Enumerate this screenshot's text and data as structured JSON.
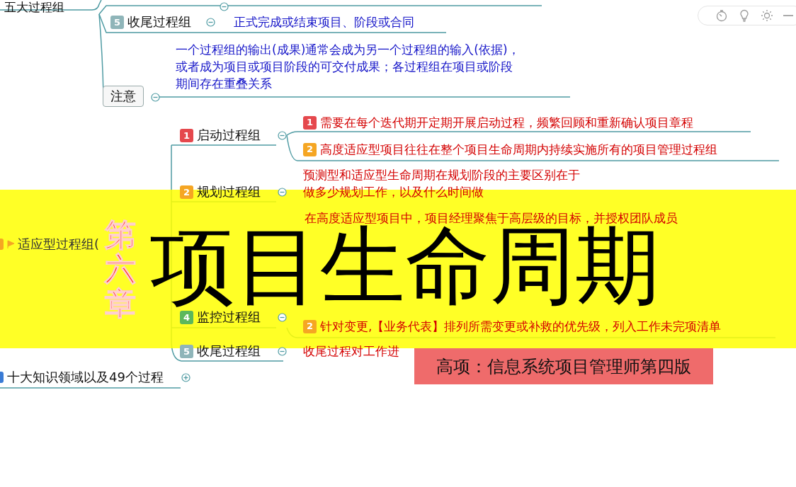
{
  "toolbar": {
    "tools": [
      {
        "kind": "timer"
      },
      {
        "kind": "bulb"
      },
      {
        "kind": "sun"
      }
    ]
  },
  "root_branch": {
    "label": "五大过程组",
    "expanded": true
  },
  "closing_node": {
    "badge": "5",
    "color": "#8fb5b9",
    "label": "收尾过程组",
    "expanded": true,
    "note": "正式完成或结束项目、阶段或合同"
  },
  "note_node": {
    "label": "注意",
    "expanded": true,
    "lines": [
      "一个过程组的输出(成果)通常会成为另一个过程组的输入(依据)，",
      "或者成为项目或项目阶段的可交付成果；各过程组在项目或阶段",
      "期间存在重叠关系"
    ]
  },
  "adaptive_node": {
    "label": "适应型过程组("
  },
  "groups": [
    {
      "badge": "1",
      "color": "#e5484d",
      "label": "启动过程组",
      "expanded": true,
      "notes": [
        {
          "badge": "1",
          "color": "#e5484d",
          "text": "需要在每个迭代期开定期开展启动过程，频繁回顾和重新确认项目章程"
        },
        {
          "badge": "2",
          "color": "#f5a623",
          "text": "高度适应型项目往往在整个项目生命周期内持续实施所有的项目管理过程组"
        }
      ]
    },
    {
      "badge": "2",
      "color": "#f5a623",
      "label": "规划过程组",
      "expanded": true,
      "notes": [
        {
          "text": "预测型和适应型生命周期在规划阶段的主要区别在于"
        },
        {
          "text": "做多少规划工作，以及什么时间做"
        }
      ]
    },
    {
      "badge": "4",
      "color": "#5cb85c",
      "label": "监控过程组",
      "expanded": true,
      "notes": [
        {
          "badge": "2",
          "color": "#f5a623",
          "text": "针对变更,【业务代表】排列所需变更或补救的优先级，列入工作未完项清单"
        }
      ]
    },
    {
      "badge": "5",
      "color": "#8fb5b9",
      "label": "收尾过程组",
      "expanded": true,
      "notes": [
        {
          "text": "收尾过程对工作进"
        }
      ]
    }
  ],
  "execution_note": {
    "text": "在高度适应型项目中，项目经理聚焦于高层级的目标，并授权团队成员"
  },
  "knowledge_node": {
    "label": "十大知识领域以及49个过程",
    "expanded": false
  },
  "banner": {
    "chapter": "第六章",
    "title": "项目生命周期"
  },
  "caption": "高项：信息系统项目管理师第四版"
}
